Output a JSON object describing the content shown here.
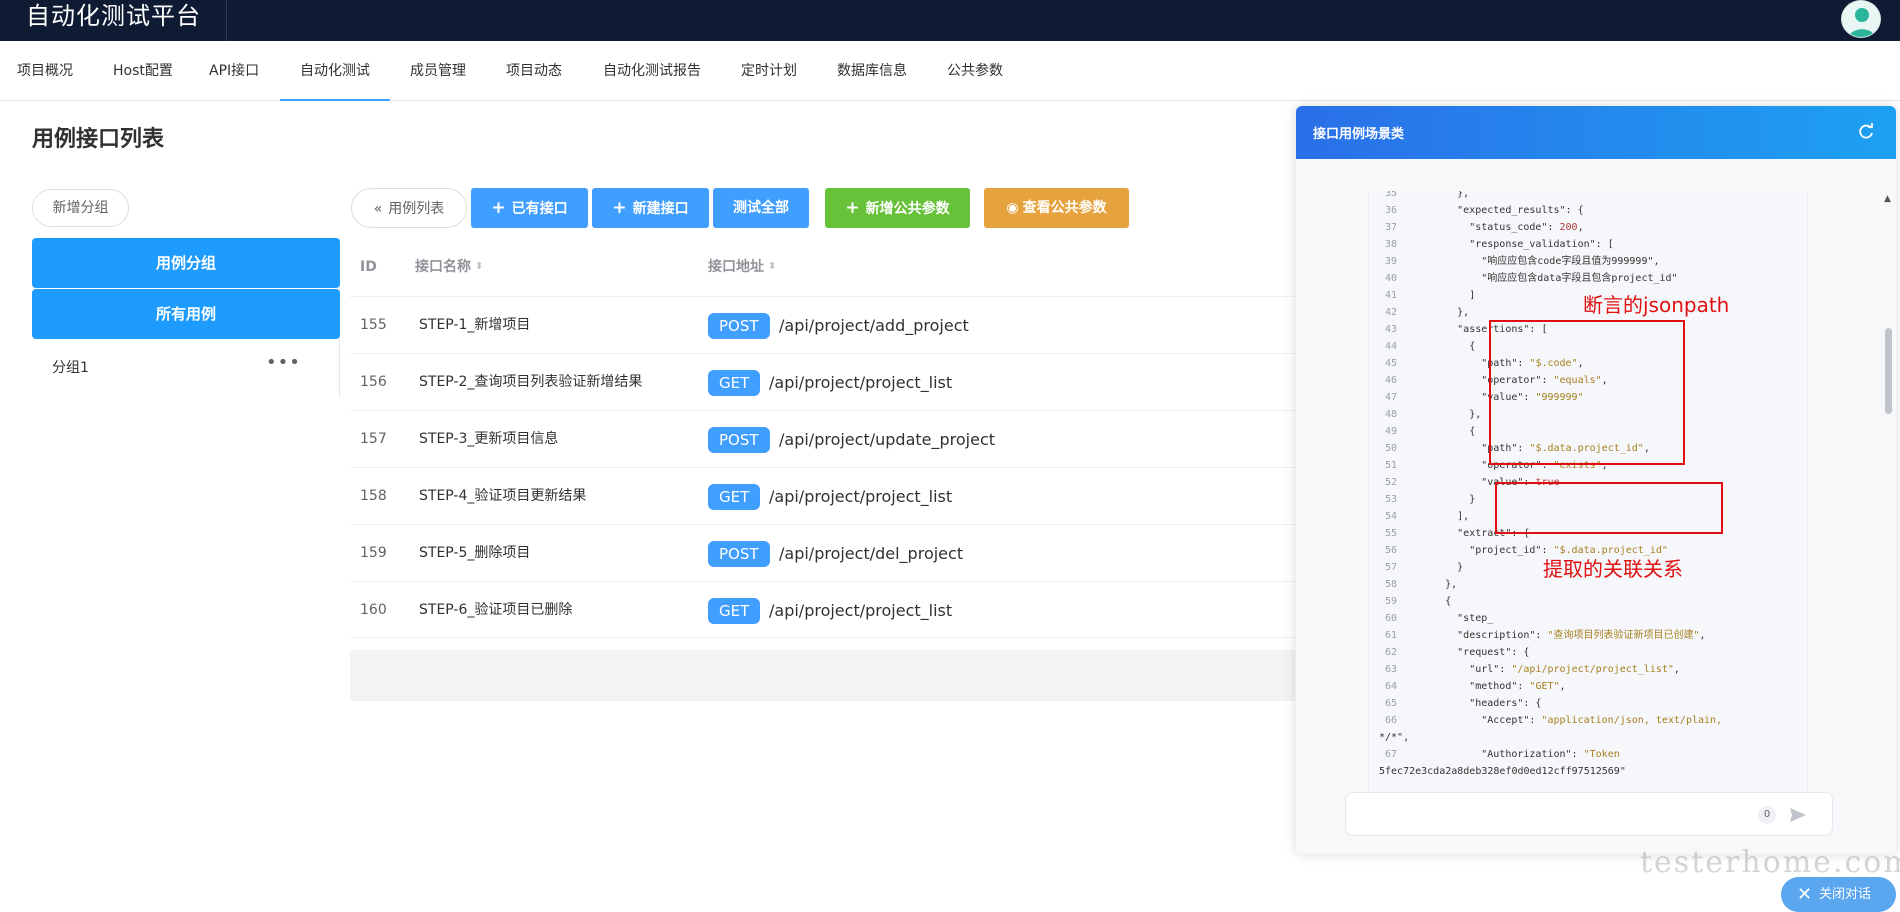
{
  "app": {
    "title": "自动化测试平台"
  },
  "nav": {
    "items": [
      "项目概况",
      "Host配置",
      "API接口",
      "自动化测试",
      "成员管理",
      "项目动态",
      "自动化测试报告",
      "定时计划",
      "数据库信息",
      "公共参数"
    ],
    "active": "自动化测试"
  },
  "page": {
    "title": "用例接口列表"
  },
  "sidebar": {
    "add_group": "新增分组",
    "header": "用例分组",
    "all_cases": "所有用例",
    "groups": [
      {
        "label": "分组1",
        "menu": "•••"
      }
    ]
  },
  "toolbar": {
    "back": "用例列表",
    "existing_api": "已有接口",
    "new_api": "新建接口",
    "test_all": "测试全部",
    "add_public_param": "新增公共参数",
    "view_public_param": "查看公共参数"
  },
  "table": {
    "columns": {
      "id": "ID",
      "name": "接口名称",
      "url": "接口地址"
    },
    "rows": [
      {
        "id": "155",
        "name": "STEP-1_新增项目",
        "method": "POST",
        "url": "/api/project/add_project"
      },
      {
        "id": "156",
        "name": "STEP-2_查询项目列表验证新增结果",
        "method": "GET",
        "url": "/api/project/project_list"
      },
      {
        "id": "157",
        "name": "STEP-3_更新项目信息",
        "method": "POST",
        "url": "/api/project/update_project"
      },
      {
        "id": "158",
        "name": "STEP-4_验证项目更新结果",
        "method": "GET",
        "url": "/api/project/project_list"
      },
      {
        "id": "159",
        "name": "STEP-5_删除项目",
        "method": "POST",
        "url": "/api/project/del_project"
      },
      {
        "id": "160",
        "name": "STEP-6_验证项目已删除",
        "method": "GET",
        "url": "/api/project/project_list"
      }
    ]
  },
  "drawer": {
    "title": "接口用例场景类",
    "annotation_assert": "断言的jsonpath",
    "annotation_extract": "提取的关联关系",
    "code": [
      {
        "n": "35",
        "t": "        },"
      },
      {
        "n": "36",
        "t": "        \"expected_results\": {"
      },
      {
        "n": "37",
        "t": "          \"status_code\": 200,"
      },
      {
        "n": "38",
        "t": "          \"response_validation\": ["
      },
      {
        "n": "39",
        "t": "            \"响应应包含code字段且值为999999\","
      },
      {
        "n": "40",
        "t": "            \"响应应包含data字段且包含project_id\""
      },
      {
        "n": "41",
        "t": "          ]"
      },
      {
        "n": "42",
        "t": "        },"
      },
      {
        "n": "43",
        "t": "        \"assertions\": ["
      },
      {
        "n": "44",
        "t": "          {"
      },
      {
        "n": "45",
        "t": "            \"path\": \"$.code\","
      },
      {
        "n": "46",
        "t": "            \"operator\": \"equals\","
      },
      {
        "n": "47",
        "t": "            \"value\": \"999999\""
      },
      {
        "n": "48",
        "t": "          },"
      },
      {
        "n": "49",
        "t": "          {"
      },
      {
        "n": "50",
        "t": "            \"path\": \"$.data.project_id\","
      },
      {
        "n": "51",
        "t": "            \"operator\": \"exists\","
      },
      {
        "n": "52",
        "t": "            \"value\": true"
      },
      {
        "n": "53",
        "t": "          }"
      },
      {
        "n": "54",
        "t": "        ],"
      },
      {
        "n": "55",
        "t": "        \"extract\": {"
      },
      {
        "n": "56",
        "t": "          \"project_id\": \"$.data.project_id\""
      },
      {
        "n": "57",
        "t": "        }"
      },
      {
        "n": "58",
        "t": "      },"
      },
      {
        "n": "59",
        "t": "      {"
      },
      {
        "n": "60",
        "t": "        \"step_"
      },
      {
        "n": "61",
        "t": "        \"description\": \"查询项目列表验证新项目已创建\","
      },
      {
        "n": "62",
        "t": "        \"request\": {"
      },
      {
        "n": "63",
        "t": "          \"url\": \"/api/project/project_list\","
      },
      {
        "n": "64",
        "t": "          \"method\": \"GET\","
      },
      {
        "n": "65",
        "t": "          \"headers\": {"
      },
      {
        "n": "66",
        "t": "            \"Accept\": \"application/json, text/plain,"
      },
      {
        "n": "",
        "t": "*/*\","
      },
      {
        "n": "67",
        "t": "            \"Authorization\": \"Token"
      },
      {
        "n": "",
        "t": "5fec72e3cda2a8deb328ef0d0ed12cff97512569\""
      }
    ],
    "input_count": "0"
  },
  "footer": {
    "close_chat": "关闭对话",
    "watermark": "testerhome.com"
  },
  "colors": {
    "primary": "#409eff",
    "success": "#67c23a",
    "warning": "#e6a23c",
    "annotation": "#e01010",
    "topbar": "#0f1a33"
  }
}
